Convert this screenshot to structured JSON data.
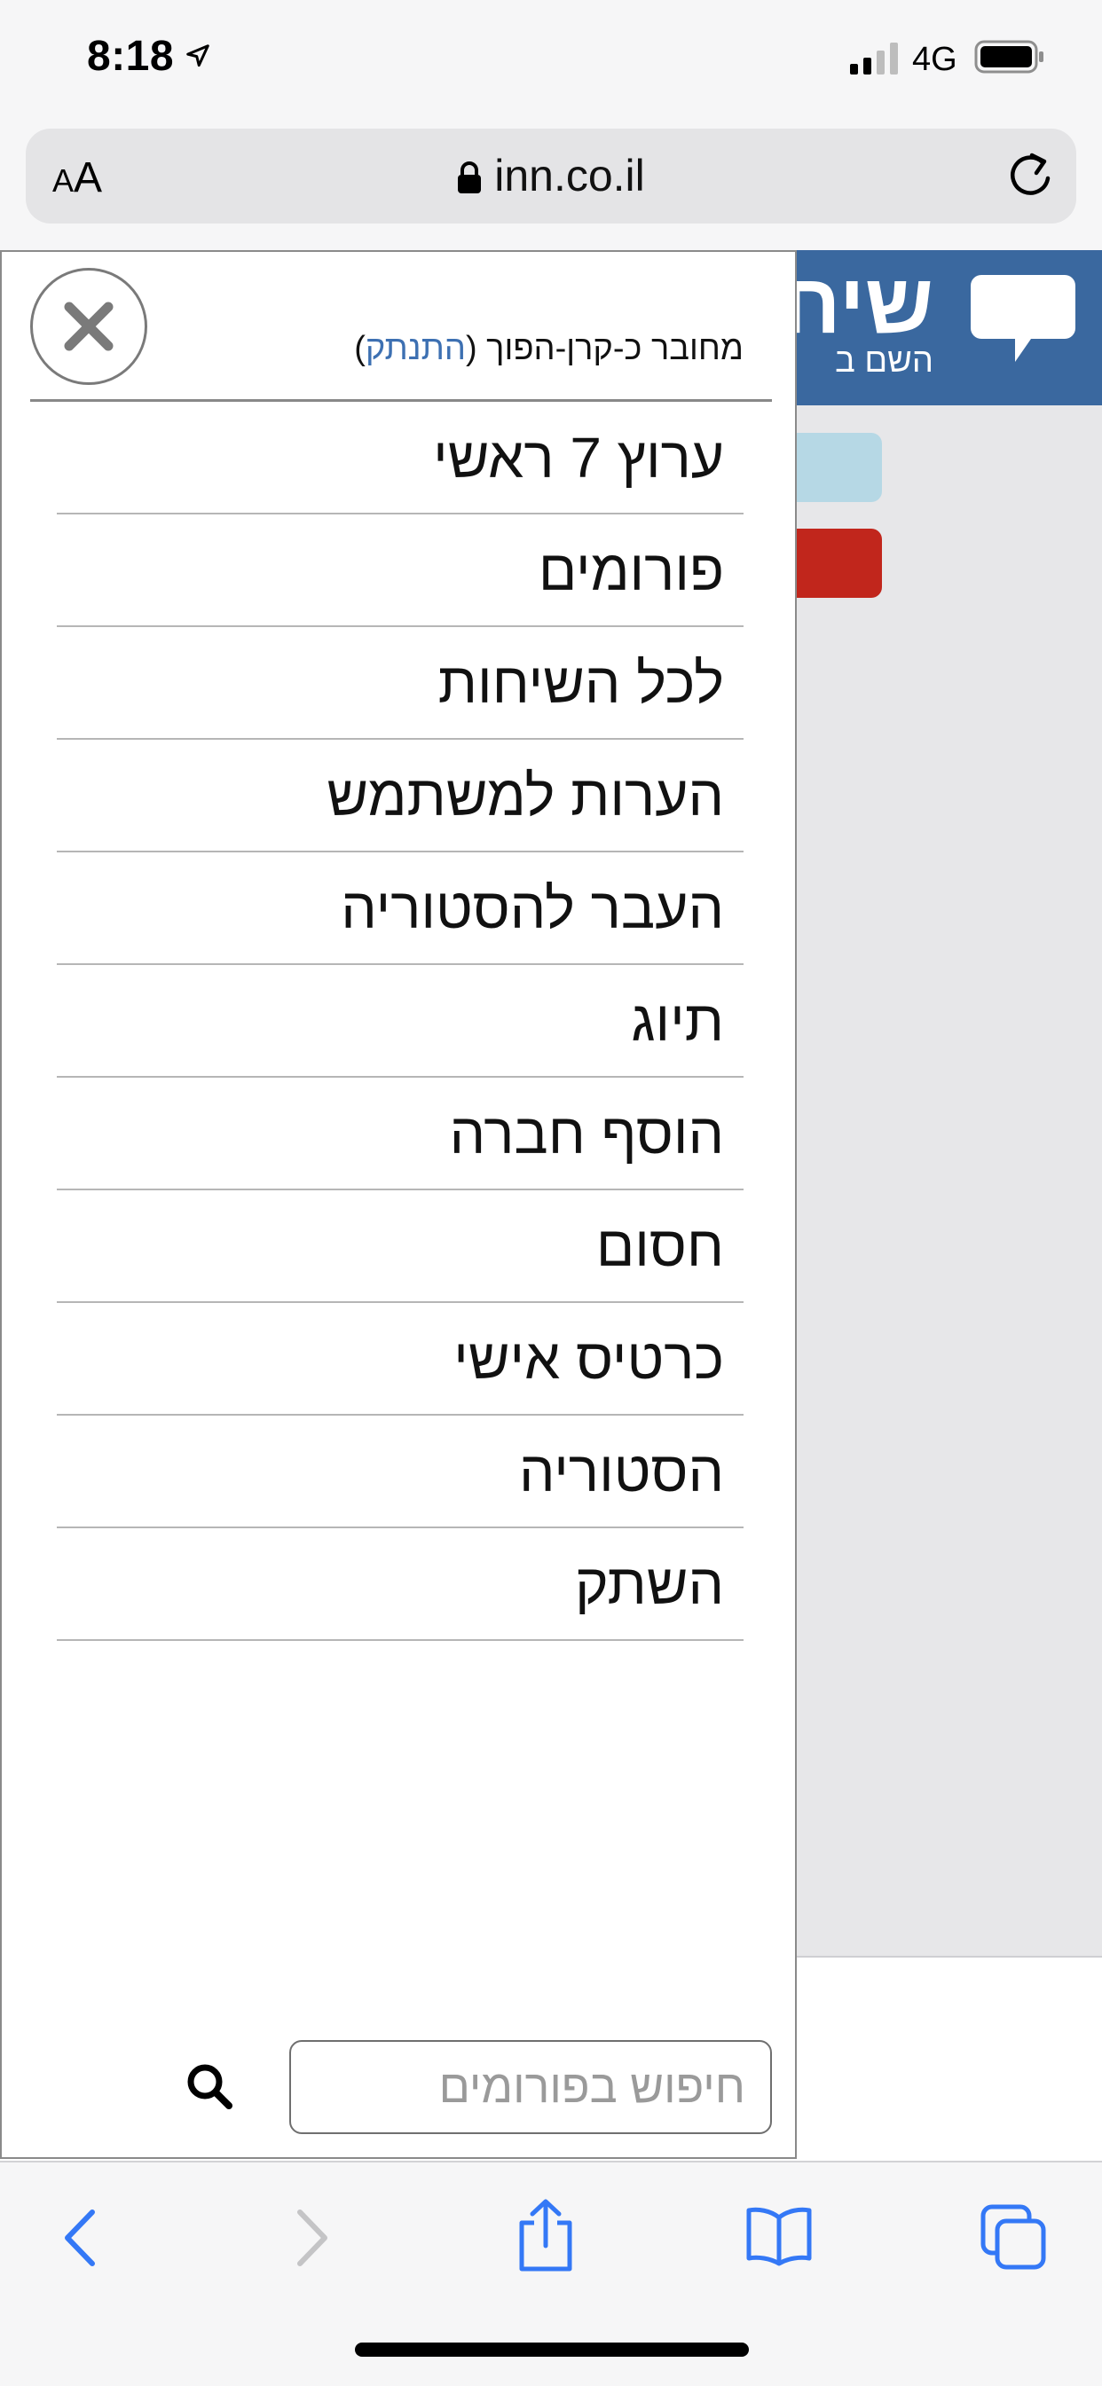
{
  "status_bar": {
    "time": "8:18",
    "network": "4G",
    "icons": [
      "location-arrow-icon",
      "signal-bars-icon",
      "battery-icon"
    ]
  },
  "browser": {
    "text_size_label_small": "A",
    "text_size_label_large": "A",
    "url": "inn.co.il",
    "icons": [
      "lock-icon",
      "reload-icon"
    ]
  },
  "page": {
    "header_title": "שיח",
    "header_subtitle": "השם ב",
    "header_color": "#3a689f",
    "accent_light": "#b6d8e5",
    "accent_red": "#c1261c"
  },
  "menu": {
    "login_prefix": "מחובר כ-קרן-הפוך",
    "login_paren_open": "(",
    "logout_label": "התנתק",
    "login_paren_close": ")",
    "items": [
      {
        "label": "ערוץ 7 ראשי"
      },
      {
        "label": "פורומים"
      },
      {
        "label": "לכל השיחות"
      },
      {
        "label": "הערות למשתמש"
      },
      {
        "label": "העבר להסטוריה"
      },
      {
        "label": "תיוג"
      },
      {
        "label": "הוסף חברה"
      },
      {
        "label": "חסום"
      },
      {
        "label": "כרטיס אישי"
      },
      {
        "label": "הסטוריה"
      },
      {
        "label": "השתק"
      }
    ],
    "search_placeholder": "חיפוש בפורומים",
    "link_color": "#3d70b2"
  },
  "toolbar": {
    "icons": [
      "back-icon",
      "forward-icon",
      "share-icon",
      "bookmarks-icon",
      "tabs-icon"
    ],
    "accent_color": "#3478f6"
  }
}
